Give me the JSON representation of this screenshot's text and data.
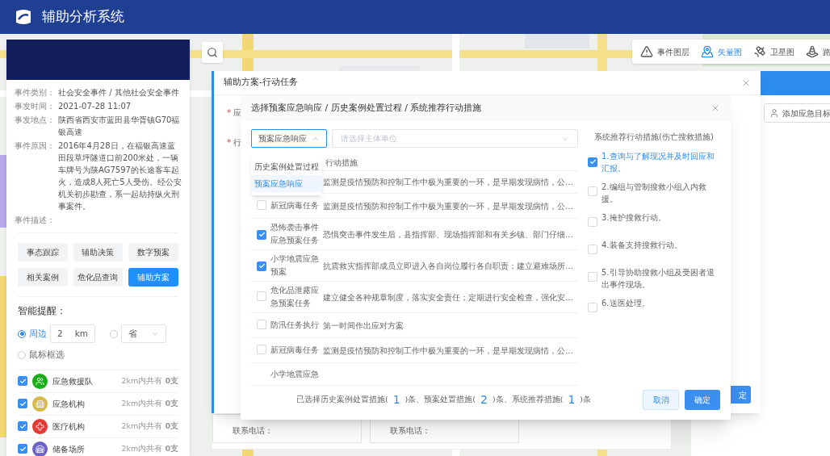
{
  "header": {
    "title": "辅助分析系统"
  },
  "map_toolbar": [
    {
      "kind": "layer",
      "label": "事件图层",
      "selected": false
    },
    {
      "kind": "vector",
      "label": "矢量图",
      "selected": true
    },
    {
      "kind": "satellite",
      "label": "卫星图",
      "selected": false
    },
    {
      "kind": "traffic",
      "label": "路",
      "selected": false
    }
  ],
  "event_panel": {
    "fields": [
      {
        "label": "事件类别：",
        "value": "社会安全事件 / 其他社会安全事件"
      },
      {
        "label": "事发时间：",
        "value": "2021-07-28 11:07"
      },
      {
        "label": "事发地点：",
        "value": "陕西省西安市蓝田县华胥镇G70福银高速"
      },
      {
        "label": "事件原因：",
        "value": "2016年4月28日，在福银高速蓝田段草坪隧道口前200米处，一辆车牌号为陕AG7597的长途客车起火，造成8人死亡5人受伤。经公安机关初步勘查，系一起劫持纵火刑事案件。"
      },
      {
        "label": "事件描述："
      }
    ],
    "actions": [
      {
        "label": "事态跟踪",
        "selected": false
      },
      {
        "label": "辅助决策",
        "selected": false
      },
      {
        "label": "数字预案",
        "selected": false
      },
      {
        "label": "相关案例",
        "selected": false
      },
      {
        "label": "危化品查询",
        "selected": false
      },
      {
        "label": "辅助方案",
        "selected": true
      }
    ],
    "reminder_title": "智能提醒：",
    "scope_options": [
      {
        "kind": "distance",
        "label": "周边",
        "selected": true,
        "value": "2",
        "unit": "km"
      },
      {
        "kind": "region",
        "selected": false,
        "value": "省"
      },
      {
        "kind": "plain",
        "label": "鼠标框选",
        "selected": false
      }
    ],
    "resources": [
      {
        "kind": "team",
        "name": "应急救援队",
        "summary": "2km内共有 **0支**",
        "checked": true,
        "color": "#1aad19"
      },
      {
        "kind": "agency",
        "name": "应急机构",
        "summary": "2km内共有 **0支**",
        "checked": true,
        "color": "#d6b94a"
      },
      {
        "kind": "medical",
        "name": "医疗机构",
        "summary": "2km内共有 **0支**",
        "checked": true,
        "color": "#e53935"
      },
      {
        "kind": "storage",
        "name": "储备场所",
        "summary": "2km内共有 **0支**",
        "checked": true,
        "color": "#6b63c8"
      }
    ]
  },
  "target_panel": {
    "button": "添加应急目标"
  },
  "task_dialog": {
    "title": "辅助方案-行动任务",
    "field_labels": [
      {
        "mark": "*",
        "label": "应"
      },
      {
        "mark": "*",
        "label": "行"
      }
    ],
    "contact_labels": [
      "联系电话：",
      "联系电话："
    ],
    "confirm": "定"
  },
  "select_dialog": {
    "title": "选择预案应急响应 / 历史案例处置过程 / 系统推荐行动措施",
    "source_select": {
      "value": "预案应急响应",
      "expanded": true,
      "options": [
        {
          "label": "历史案例处置过程",
          "selected": false
        },
        {
          "label": "预案应急响应",
          "selected": true
        }
      ]
    },
    "unit_select": {
      "placeholder": "请选择主体单位"
    },
    "column_header": "行动措施",
    "rows": [
      {
        "action": "监测是疫情预防和控制工作中极为重要的一环，是早期发现病情，公…"
      },
      {
        "name": "新冠病毒任务",
        "action": "监测是疫情预防和控制工作中极为重要的一环，是早期发现病情，公…",
        "checked": false
      },
      {
        "name": "恐怖袭击事件应急预案任务",
        "action": "恐惧突击事件发生后，县指挥部、现场指挥部和有关乡镇、部门仔细…",
        "checked": true
      },
      {
        "name": "小学地震应急预案",
        "action": "抗震救灾指挥部成员立即进入各自岗位履行各自职责；建立避难场所…",
        "checked": true
      },
      {
        "name": "危化品泄露应急预案任务",
        "action": "建立健全各种规章制度，落实安全责任；定期进行安全检查，强化安…",
        "checked": false
      },
      {
        "name": "防汛任务执行",
        "action": "第一时间作出应对方案",
        "checked": false
      },
      {
        "name": "新冠病毒任务",
        "action": "监测是疫情预防和控制工作中极为重要的一环，是早期发现病情，公…",
        "checked": false
      },
      {
        "name": "小学地震应急"
      }
    ],
    "recommend_title": "系统推荐行动措施(伤亡搜救措施)",
    "recommendations": [
      {
        "label": "1.查询与了解现况并及时回应和汇报。",
        "checked": true
      },
      {
        "label": "2.编组与管制搜救小组入内救援。",
        "checked": false
      },
      {
        "label": "3.掩护搜救行动。",
        "checked": false
      },
      {
        "label": "4.装备支持搜救行动。",
        "checked": false
      },
      {
        "label": "5.引导协助搜救小组及受困者退出事件现场。",
        "checked": false
      },
      {
        "label": "6.送医处理。",
        "checked": false
      }
    ],
    "summary": [
      {
        "kind": "text",
        "text": "已选择历史案例处置措施("
      },
      {
        "kind": "count",
        "text": "1"
      },
      {
        "kind": "text",
        "text": ")条、预案处置措施("
      },
      {
        "kind": "count",
        "text": "2"
      },
      {
        "kind": "text",
        "text": ")条、系统推荐措施("
      },
      {
        "kind": "count",
        "text": "1"
      },
      {
        "kind": "text",
        "text": ")条"
      }
    ],
    "cancel": "取消",
    "confirm": "确定"
  }
}
